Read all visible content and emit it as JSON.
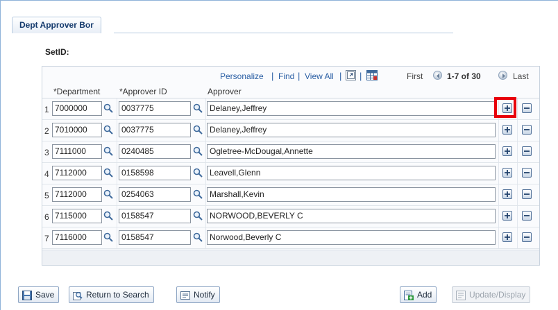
{
  "page": {
    "tab_title": "Dept Approver Bor",
    "setid_label": "SetID:"
  },
  "grid_nav": {
    "personalize": "Personalize",
    "find": "Find",
    "view_all": "View All",
    "sep": "|",
    "first": "First",
    "range": "1-7 of 30",
    "last": "Last"
  },
  "columns": {
    "department": "*Department",
    "approver_id": "*Approver ID",
    "approver": "Approver"
  },
  "rows": [
    {
      "num": "1",
      "department": "7000000",
      "approver_id": "0037775",
      "approver": "Delaney,Jeffrey"
    },
    {
      "num": "2",
      "department": "7010000",
      "approver_id": "0037775",
      "approver": "Delaney,Jeffrey"
    },
    {
      "num": "3",
      "department": "7111000",
      "approver_id": "0240485",
      "approver": "Ogletree-McDougal,Annette"
    },
    {
      "num": "4",
      "department": "7112000",
      "approver_id": "0158598",
      "approver": "Leavell,Glenn"
    },
    {
      "num": "5",
      "department": "7112000",
      "approver_id": "0254063",
      "approver": "Marshall,Kevin"
    },
    {
      "num": "6",
      "department": "7115000",
      "approver_id": "0158547",
      "approver": "NORWOOD,BEVERLY C"
    },
    {
      "num": "7",
      "department": "7116000",
      "approver_id": "0158547",
      "approver": "Norwood,Beverly C"
    }
  ],
  "toolbar": {
    "save": "Save",
    "return_to_search": "Return to Search",
    "notify": "Notify",
    "add": "Add",
    "update_display": "Update/Display"
  },
  "icons": {
    "lookup": "magnifier-icon",
    "add_row": "plus-icon",
    "delete_row": "minus-icon",
    "zoom": "zoom-icon",
    "download": "spreadsheet-icon",
    "highlight_color": "#e8000b"
  }
}
